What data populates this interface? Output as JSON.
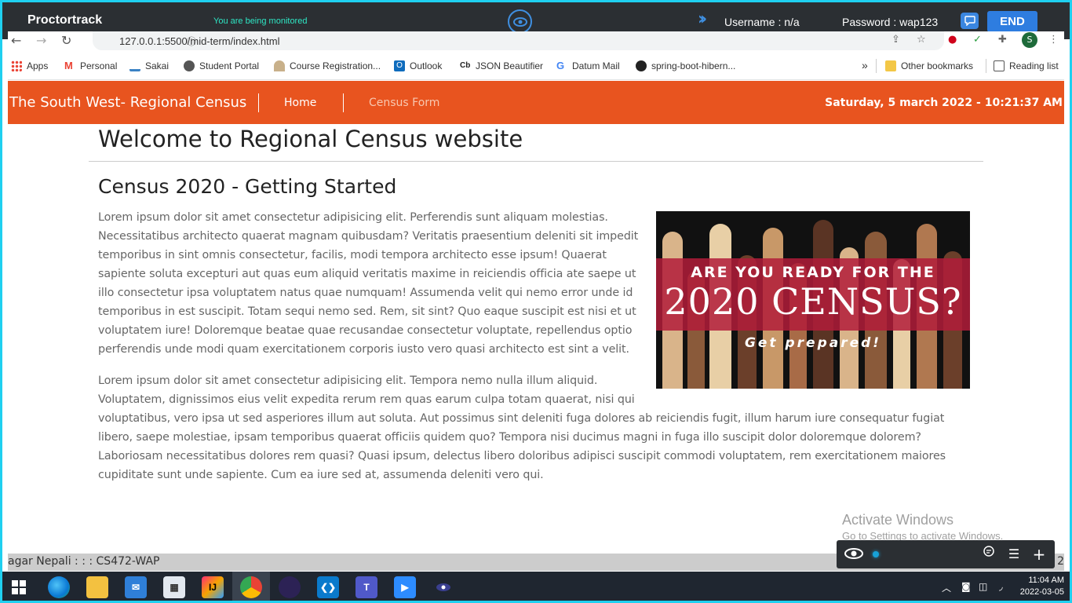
{
  "proctor": {
    "brand": "Proctortrack",
    "monitored": "You are being monitored",
    "username": "Username : n/a",
    "password": "Password : wap123",
    "end_label": "END"
  },
  "browser": {
    "url": "127.0.0.1:5500/mid-term/index.html",
    "profile_initial": "S",
    "bookmarks": [
      {
        "label": "Apps",
        "icon": "apps-grid-icon"
      },
      {
        "label": "Personal",
        "icon": "gmail-icon"
      },
      {
        "label": "Sakai",
        "icon": "sakai-icon"
      },
      {
        "label": "Student Portal",
        "icon": "globe-icon"
      },
      {
        "label": "Course Registration...",
        "icon": "course-icon"
      },
      {
        "label": "Outlook",
        "icon": "outlook-icon"
      },
      {
        "label": "JSON Beautifier",
        "icon": "json-icon"
      },
      {
        "label": "Datum Mail",
        "icon": "google-icon"
      },
      {
        "label": "spring-boot-hibern...",
        "icon": "github-icon"
      }
    ],
    "overflow": "»",
    "other_bookmarks": "Other bookmarks",
    "reading_list": "Reading list"
  },
  "site": {
    "title": "The South West- Regional Census",
    "nav": {
      "home": "Home",
      "census_form": "Census Form"
    },
    "datetime": "Saturday, 5 march 2022 - 10:21:37 AM"
  },
  "main": {
    "welcome": "Welcome to Regional Census website",
    "heading": "Census 2020 - Getting Started",
    "para1": "Lorem ipsum dolor sit amet consectetur adipisicing elit. Perferendis sunt aliquam molestias. Necessitatibus architecto quaerat magnam quibusdam? Veritatis praesentium deleniti sit impedit temporibus in sint omnis consectetur, facilis, modi tempora architecto esse ipsum! Quaerat sapiente soluta excepturi aut quas eum aliquid veritatis maxime in reiciendis officia ate saepe ut illo consectetur ipsa voluptatem natus quae numquam! Assumenda velit qui nemo error unde id temporibus in est suscipit. Totam sequi nemo sed. Rem, sit sint? Quo eaque suscipit est nisi et ut voluptatem iure! Doloremque beatae quae recusandae consectetur voluptate, repellendus optio perferendis unde modi quam exercitationem corporis iusto vero quasi architecto est sint a velit.",
    "para2_a": "Lorem ipsum dolor sit amet consectetur adipisicing elit. Tempora nemo nulla illum aliquid. Voluptatem, dignissimos eius velit expedita rerum rem quas earum culpa totam quaerat, nisi qui",
    "para2_b": "voluptatibus, vero ipsa ut sed asperiores illum aut soluta. Aut possimus sint deleniti fuga dolores ab reiciendis fugit, illum harum iure consequatur fugiat libero, saepe molestiae, ipsam temporibus quaerat officiis quidem quo? Tempora nisi ducimus magni in fuga illo suscipit dolor doloremque dolorem? Laboriosam necessitatibus dolores rem quasi? Quasi ipsum, delectus libero doloribus adipisci suscipit commodi voluptatem, rem exercitationem maiores cupiditate sunt unde sapiente. Cum ea iure sed at, assumenda deleniti vero qui.",
    "image": {
      "line1": "ARE YOU READY FOR THE",
      "line2": "2020 CENSUS?",
      "line3": "Get prepared!"
    }
  },
  "activate": {
    "title": "Activate Windows",
    "subtitle": "Go to Settings to activate Windows."
  },
  "footer": {
    "text": "agar Nepali : : : CS472-WAP",
    "right": "2"
  },
  "taskbar": {
    "time": "11:04 AM",
    "date": "2022-03-05"
  },
  "colors": {
    "header": "#e8541f",
    "proctor_bg": "#2b2f33",
    "accent_blue": "#2e7de0",
    "frame": "#1fd0f0"
  }
}
